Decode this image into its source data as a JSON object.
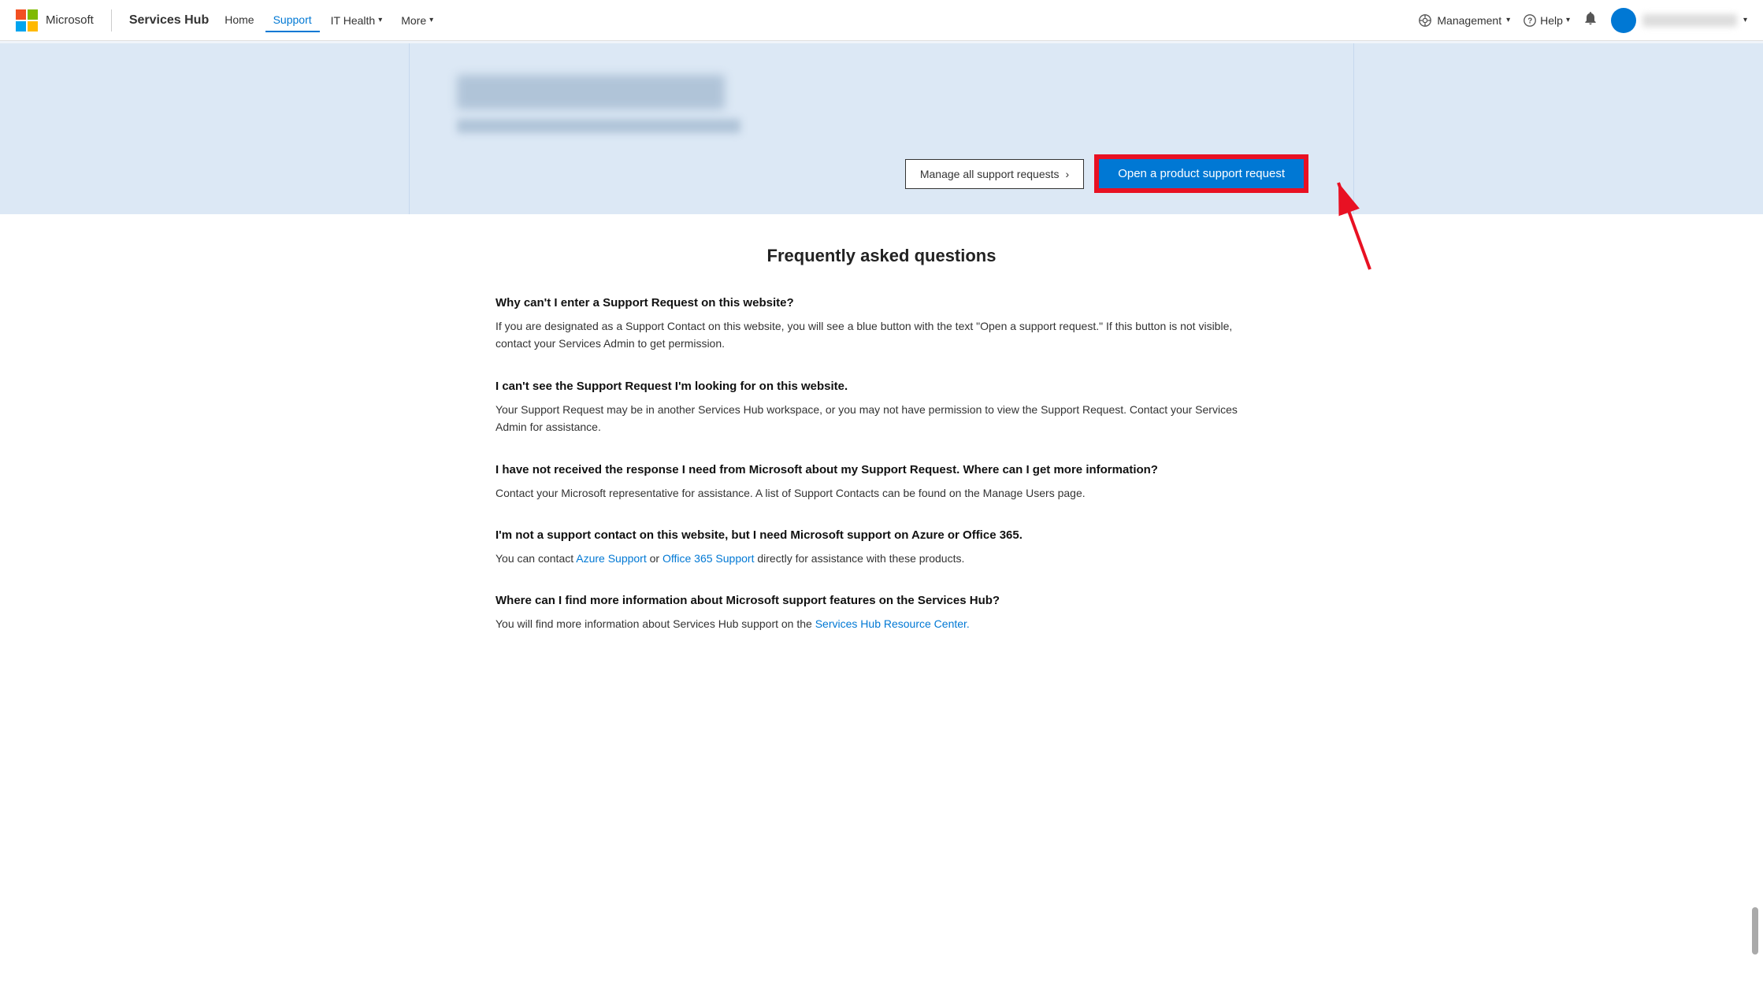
{
  "navbar": {
    "brand": "Services Hub",
    "links": [
      {
        "label": "Home",
        "active": false
      },
      {
        "label": "Support",
        "active": true
      },
      {
        "label": "IT Health",
        "hasArrow": true
      },
      {
        "label": "More",
        "hasArrow": true
      }
    ],
    "management_label": "Management",
    "help_label": "Help",
    "chevron": "▾"
  },
  "hero": {
    "manage_btn": "Manage all support requests",
    "open_btn": "Open a product support request"
  },
  "faq": {
    "title": "Frequently asked questions",
    "items": [
      {
        "question": "Why can't I enter a Support Request on this website?",
        "answer": "If you are designated as a Support Contact on this website, you will see a blue button with the text \"Open a support request.\" If this button is not visible, contact your Services Admin to get permission."
      },
      {
        "question": "I can't see the Support Request I'm looking for on this website.",
        "answer": "Your Support Request may be in another Services Hub workspace, or you may not have permission to view the Support Request. Contact your Services Admin for assistance."
      },
      {
        "question": "I have not received the response I need from Microsoft about my Support Request. Where can I get more information?",
        "answer": "Contact your Microsoft representative for assistance. A list of Support Contacts can be found on the Manage Users page."
      },
      {
        "question": "I'm not a support contact on this website, but I need Microsoft support on Azure or Office 365.",
        "answer_parts": [
          "You can contact ",
          "Azure Support",
          " or ",
          "Office 365 Support",
          " directly for assistance with these products."
        ],
        "links": [
          "Azure Support",
          "Office 365 Support"
        ]
      },
      {
        "question": "Where can I find more information about Microsoft support features on the Services Hub?",
        "answer_parts": [
          "You will find more information about Services Hub support on the ",
          "Services Hub Resource Center."
        ],
        "links": [
          "Services Hub Resource Center."
        ]
      }
    ]
  }
}
